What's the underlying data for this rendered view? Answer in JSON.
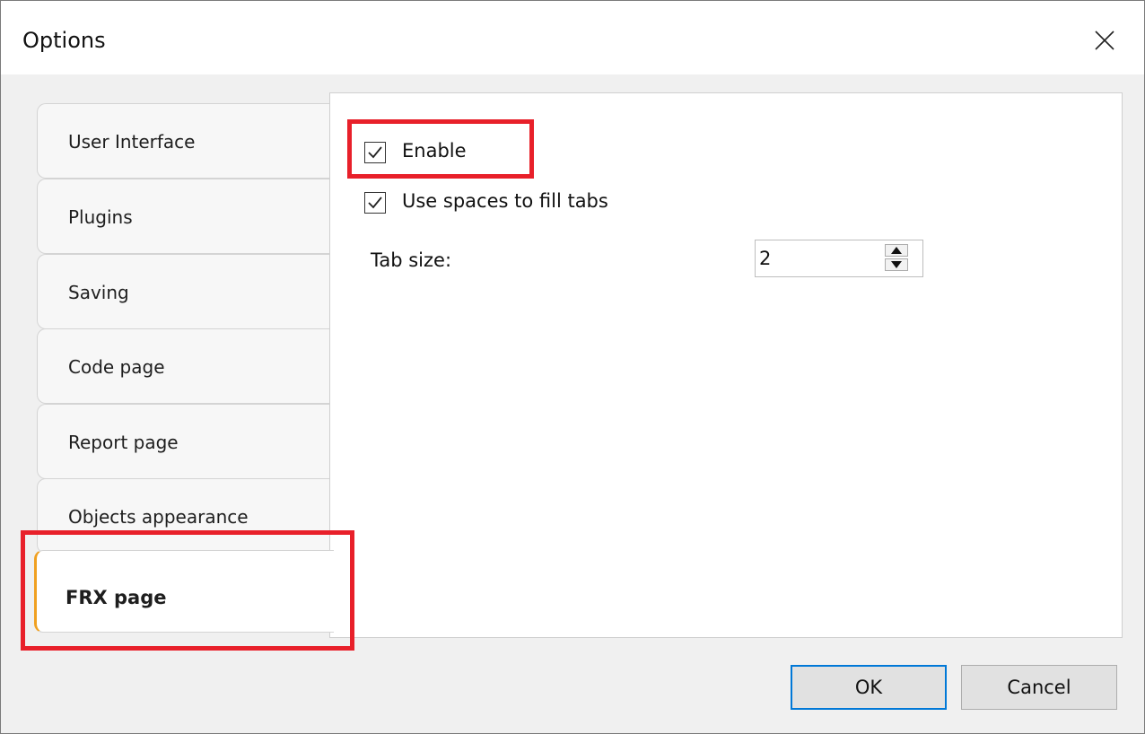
{
  "window": {
    "title": "Options"
  },
  "tabs": [
    {
      "label": "User Interface",
      "active": false
    },
    {
      "label": "Plugins",
      "active": false
    },
    {
      "label": "Saving",
      "active": false
    },
    {
      "label": "Code page",
      "active": false
    },
    {
      "label": "Report page",
      "active": false
    },
    {
      "label": "Objects appearance",
      "active": false
    },
    {
      "label": "FRX page",
      "active": true
    }
  ],
  "panel": {
    "enable": {
      "label": "Enable",
      "checked": true
    },
    "use_spaces": {
      "label": "Use spaces to fill tabs",
      "checked": true
    },
    "tab_size": {
      "label": "Tab size:",
      "value": "2"
    }
  },
  "buttons": {
    "ok": "OK",
    "cancel": "Cancel"
  },
  "colors": {
    "highlight": "#e8202a",
    "active_tab_accent": "#f0a020",
    "default_button_border": "#0078d7"
  },
  "icons": {
    "close": "close-icon",
    "check": "checkmark-icon",
    "spin_up": "triangle-up-icon",
    "spin_down": "triangle-down-icon"
  }
}
